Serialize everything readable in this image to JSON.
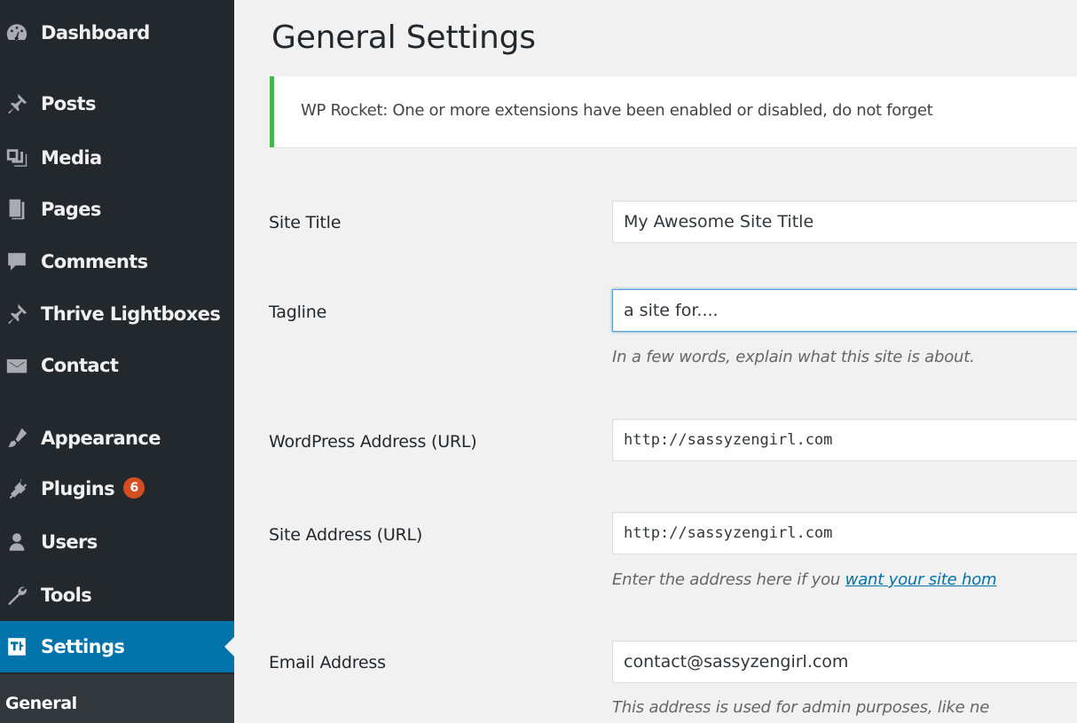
{
  "sidebar": {
    "items": [
      {
        "label": "Dashboard",
        "icon": "dashboard-icon"
      },
      {
        "label": "Posts",
        "icon": "pin-icon"
      },
      {
        "label": "Media",
        "icon": "media-icon"
      },
      {
        "label": "Pages",
        "icon": "page-icon"
      },
      {
        "label": "Comments",
        "icon": "comment-icon"
      },
      {
        "label": "Thrive Lightboxes",
        "icon": "pin-icon"
      },
      {
        "label": "Contact",
        "icon": "mail-icon"
      },
      {
        "label": "Appearance",
        "icon": "brush-icon"
      },
      {
        "label": "Plugins",
        "icon": "plug-icon",
        "badge": "6"
      },
      {
        "label": "Users",
        "icon": "user-icon"
      },
      {
        "label": "Tools",
        "icon": "wrench-icon"
      },
      {
        "label": "Settings",
        "icon": "settings-icon",
        "active": true
      }
    ],
    "submenu": {
      "label": "General"
    }
  },
  "main": {
    "title": "General Settings",
    "notice": {
      "text": "WP Rocket: One or more extensions have been enabled or disabled, do not forget"
    },
    "fields": {
      "site_title": {
        "label": "Site Title",
        "value": "My Awesome Site Title"
      },
      "tagline": {
        "label": "Tagline",
        "value": "a site for....",
        "description": "In a few words, explain what this site is about."
      },
      "wp_address": {
        "label": "WordPress Address (URL)",
        "value": "http://sassyzengirl.com"
      },
      "site_address": {
        "label": "Site Address (URL)",
        "value": "http://sassyzengirl.com",
        "description_prefix": "Enter the address here if you ",
        "description_link": "want your site hom"
      },
      "email": {
        "label": "Email Address",
        "value": "contact@sassyzengirl.com",
        "description": "This address is used for admin purposes, like ne"
      }
    }
  },
  "colors": {
    "sidebar_bg": "#23282d",
    "active_bg": "#0073aa",
    "notice_border": "#46b450",
    "badge_bg": "#d54e21",
    "focus_border": "#5b9dd9"
  }
}
